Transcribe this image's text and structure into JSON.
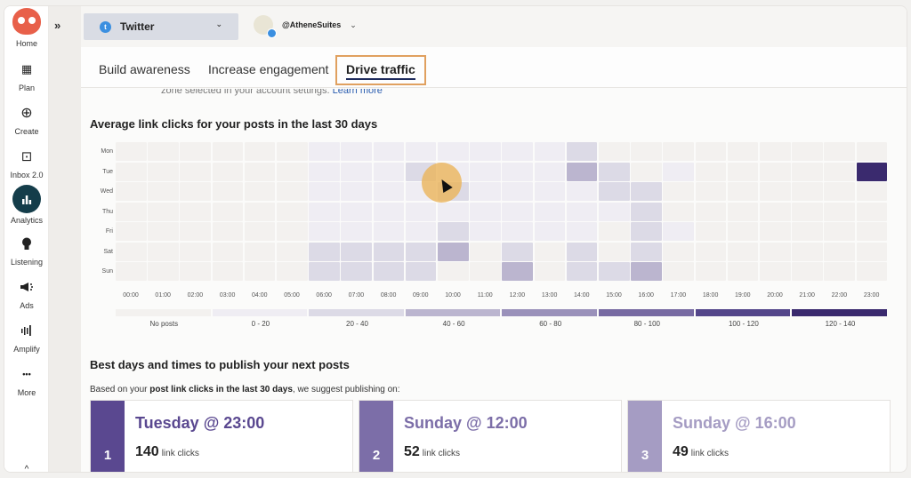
{
  "nav": {
    "items": [
      {
        "label": "Home",
        "icon": "owl-logo-icon"
      },
      {
        "label": "Plan",
        "icon": "calendar-icon"
      },
      {
        "label": "Create",
        "icon": "plus-circle-icon"
      },
      {
        "label": "Inbox 2.0",
        "icon": "inbox-icon"
      },
      {
        "label": "Analytics",
        "icon": "bar-chart-icon",
        "active": true
      },
      {
        "label": "Listening",
        "icon": "lightbulb-icon"
      },
      {
        "label": "Ads",
        "icon": "megaphone-icon"
      },
      {
        "label": "Amplify",
        "icon": "amplify-icon"
      },
      {
        "label": "More",
        "icon": "more-dots-icon"
      }
    ],
    "icons": {
      "home": "🦉",
      "plan": "▦",
      "create": "⊕",
      "inbox": "⊡",
      "analytics": "▮▮",
      "listening": "●",
      "ads": "📢",
      "amplify": "ılı",
      "more": "•••",
      "collapse": "^"
    }
  },
  "topbar": {
    "expand_icon": "»",
    "network": "Twitter",
    "network_icon": "t",
    "account": "@AtheneSuites",
    "chevron": "⌄"
  },
  "tabs": [
    {
      "label": "Build awareness"
    },
    {
      "label": "Increase engagement"
    },
    {
      "label": "Drive traffic",
      "active": true
    }
  ],
  "note": {
    "text": "zone selected in your account settings. ",
    "link": "Learn more"
  },
  "chart_data": {
    "type": "heatmap",
    "title": "Average link clicks for your posts in the last 30 days",
    "rows": [
      "Mon",
      "Tue",
      "Wed",
      "Thu",
      "Fri",
      "Sat",
      "Sun"
    ],
    "columns": [
      "00:00",
      "01:00",
      "02:00",
      "03:00",
      "04:00",
      "05:00",
      "06:00",
      "07:00",
      "08:00",
      "09:00",
      "10:00",
      "11:00",
      "12:00",
      "13:00",
      "14:00",
      "15:00",
      "16:00",
      "17:00",
      "18:00",
      "19:00",
      "20:00",
      "21:00",
      "22:00",
      "23:00"
    ],
    "values": [
      [
        null,
        null,
        null,
        null,
        null,
        null,
        10,
        10,
        10,
        10,
        10,
        10,
        10,
        10,
        30,
        null,
        null,
        null,
        null,
        null,
        null,
        null,
        null,
        null
      ],
      [
        null,
        null,
        null,
        null,
        null,
        null,
        10,
        10,
        10,
        30,
        10,
        10,
        10,
        10,
        50,
        30,
        null,
        10,
        null,
        null,
        null,
        null,
        null,
        140
      ],
      [
        null,
        null,
        null,
        null,
        null,
        null,
        10,
        10,
        10,
        10,
        30,
        10,
        10,
        10,
        10,
        30,
        30,
        null,
        null,
        null,
        null,
        null,
        null,
        null
      ],
      [
        null,
        null,
        null,
        null,
        null,
        null,
        10,
        10,
        10,
        10,
        10,
        10,
        10,
        10,
        10,
        10,
        30,
        null,
        null,
        null,
        null,
        null,
        null,
        null
      ],
      [
        null,
        null,
        null,
        null,
        null,
        null,
        10,
        10,
        10,
        10,
        30,
        10,
        10,
        10,
        10,
        null,
        30,
        10,
        null,
        null,
        null,
        null,
        null,
        null
      ],
      [
        null,
        null,
        null,
        null,
        null,
        null,
        30,
        30,
        30,
        30,
        50,
        null,
        30,
        null,
        30,
        null,
        30,
        null,
        null,
        null,
        null,
        null,
        null,
        null
      ],
      [
        null,
        null,
        null,
        null,
        null,
        null,
        30,
        30,
        30,
        30,
        null,
        null,
        50,
        null,
        30,
        30,
        50,
        null,
        null,
        null,
        null,
        null,
        null,
        null
      ]
    ],
    "legend": [
      {
        "label": "No posts",
        "color": "#f3f1ef"
      },
      {
        "label": "0 - 20",
        "color": "#efedf3"
      },
      {
        "label": "20 - 40",
        "color": "#dcdae6"
      },
      {
        "label": "40 - 60",
        "color": "#bbb5cf"
      },
      {
        "label": "60 - 80",
        "color": "#9a91ba"
      },
      {
        "label": "80 - 100",
        "color": "#776aa2"
      },
      {
        "label": "100 - 120",
        "color": "#54468a"
      },
      {
        "label": "120 - 140",
        "color": "#3a2a6e"
      }
    ],
    "legend_placement": "bottom"
  },
  "best": {
    "title": "Best days and times to publish your next posts",
    "sub_prefix": "Based on your ",
    "sub_bold": "post link clicks in the last 30 days",
    "sub_suffix": ", we suggest publishing on:",
    "cards": [
      {
        "rank": "1",
        "when": "Tuesday @ 23:00",
        "clicks": "140",
        "unit": "link clicks",
        "color": "#5a4890",
        "text_color": "#5a4890"
      },
      {
        "rank": "2",
        "when": "Sunday @ 12:00",
        "clicks": "52",
        "unit": "link clicks",
        "color": "#7c6ea8",
        "text_color": "#7c6ea8"
      },
      {
        "rank": "3",
        "when": "Sunday @ 16:00",
        "clicks": "49",
        "unit": "link clicks",
        "color": "#a59cc3",
        "text_color": "#a59cc3"
      }
    ]
  }
}
